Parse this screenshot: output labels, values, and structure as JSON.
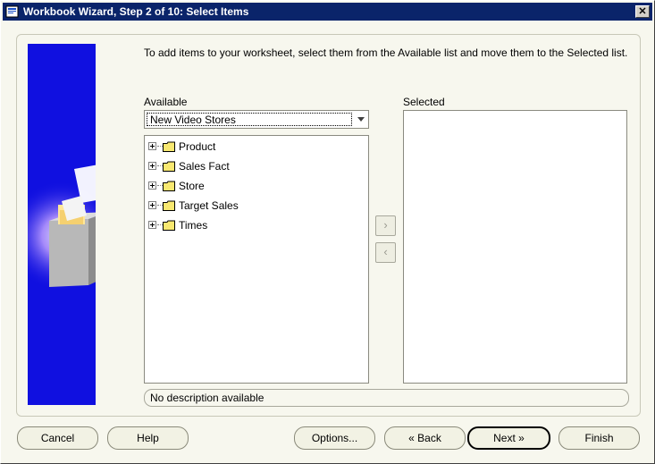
{
  "window": {
    "title": "Workbook Wizard, Step 2 of 10: Select Items",
    "close_glyph": "✕"
  },
  "instructions": "To add items to your worksheet, select them from the Available list and move them to the Selected list.",
  "available": {
    "label": "Available",
    "dropdown_value": "New Video Stores",
    "items": [
      {
        "label": "Product"
      },
      {
        "label": "Sales Fact"
      },
      {
        "label": "Store"
      },
      {
        "label": "Target Sales"
      },
      {
        "label": "Times"
      }
    ]
  },
  "selected": {
    "label": "Selected",
    "items": []
  },
  "move_buttons": {
    "add_glyph": "›",
    "remove_glyph": "‹"
  },
  "description": "No description available",
  "buttons": {
    "cancel": "Cancel",
    "help": "Help",
    "options": "Options...",
    "back": "Back",
    "next": "Next",
    "finish": "Finish"
  },
  "colors": {
    "titlebar": "#0a246a",
    "sidebar_art": "#1010e0",
    "background": "#f7f7ee"
  }
}
